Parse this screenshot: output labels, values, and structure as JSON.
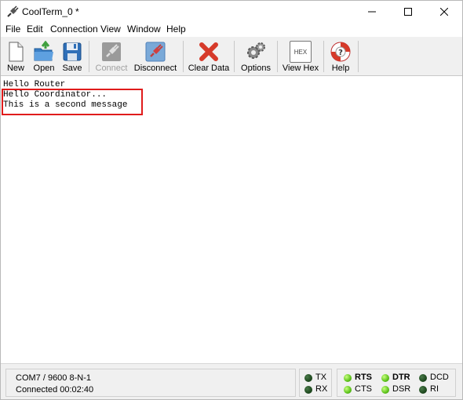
{
  "window": {
    "title": "CoolTerm_0 *"
  },
  "menu": [
    "File",
    "Edit",
    "Connection",
    "View",
    "Window",
    "Help"
  ],
  "toolbar": {
    "new": "New",
    "open": "Open",
    "save": "Save",
    "connect": "Connect",
    "disconnect": "Disconnect",
    "clear_data": "Clear Data",
    "options": "Options",
    "view_hex": "View Hex",
    "hex_icon_text": "HEX",
    "help": "Help"
  },
  "terminal": {
    "lines": [
      "Hello Router",
      "Hello Coordinator...",
      "This is a second message"
    ]
  },
  "status": {
    "port": "COM7 / 9600 8-N-1",
    "connection": "Connected 00:02:40"
  },
  "leds": {
    "tx": {
      "label": "TX",
      "on": false
    },
    "rx": {
      "label": "RX",
      "on": false
    },
    "rts": {
      "label": "RTS",
      "on": true
    },
    "cts": {
      "label": "CTS",
      "on": true
    },
    "dtr": {
      "label": "DTR",
      "on": true
    },
    "dsr": {
      "label": "DSR",
      "on": true
    },
    "dcd": {
      "label": "DCD",
      "on": false
    },
    "ri": {
      "label": "RI",
      "on": false
    }
  },
  "icons": {
    "app": "cable-plug-icon",
    "new": "new-document-icon",
    "open": "open-folder-icon",
    "save": "floppy-disk-icon",
    "connect": "connect-plug-icon",
    "disconnect": "disconnect-plug-icon",
    "clear_data": "red-x-icon",
    "options": "gears-icon",
    "view_hex": "hex-icon",
    "help": "lifebuoy-help-icon"
  },
  "colors": {
    "highlight_box": "#e01b1b",
    "led_on": "#5cc21a",
    "led_off": "#1f4a1f"
  }
}
